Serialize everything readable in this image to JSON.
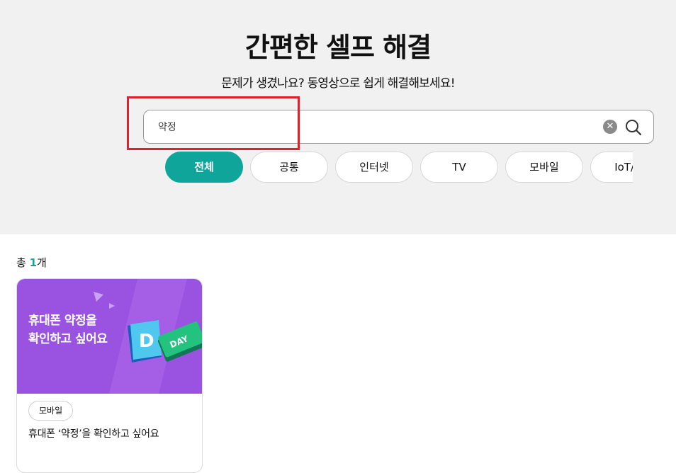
{
  "hero": {
    "title": "간편한 셀프 해결",
    "subtitle": "문제가 생겼나요? 동영상으로 쉽게 해결해보세요!"
  },
  "search": {
    "value": "약정",
    "clear_icon": "close-circle-icon",
    "search_icon": "magnifier-icon"
  },
  "categories": [
    {
      "label": "전체",
      "active": true
    },
    {
      "label": "공통",
      "active": false
    },
    {
      "label": "인터넷",
      "active": false
    },
    {
      "label": "TV",
      "active": false
    },
    {
      "label": "모바일",
      "active": false
    },
    {
      "label": "IoT/기",
      "active": false
    }
  ],
  "results": {
    "prefix": "총 ",
    "count": "1",
    "suffix": "개"
  },
  "cards": [
    {
      "thumb_line1": "휴대폰 약정을",
      "thumb_line2": "확인하고 싶어요",
      "thumb_badge_letter": "D",
      "thumb_badge_word": "DAY",
      "tag": "모바일",
      "title": "휴대폰 ‘약정’을 확인하고 싶어요"
    }
  ],
  "colors": {
    "accent": "#10a59a",
    "highlight": "#e0202a",
    "thumb_bg": "#9a52e0",
    "hero_bg": "#f1f1f1"
  }
}
